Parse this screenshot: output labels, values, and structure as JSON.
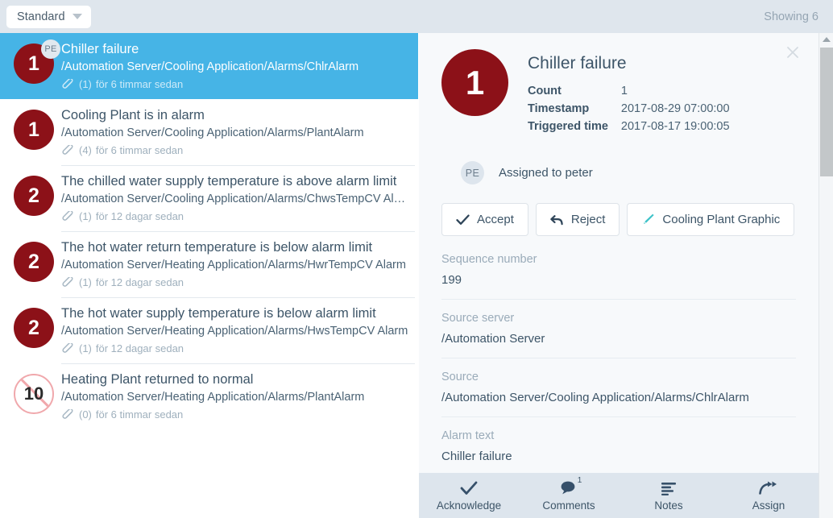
{
  "topbar": {
    "filter_label": "Standard",
    "filter_caret_icon": "chevron-down-icon",
    "showing_text": "Showing 6"
  },
  "alarm_list": {
    "rows": [
      {
        "count": "1",
        "badge_style": "alarm",
        "assignee_initials": "PE",
        "title": "Chiller failure",
        "path": "/Automation Server/Cooling Application/Alarms/ChlrAlarm",
        "attachments": "(1)",
        "age": "för 6 timmar sedan",
        "selected": true
      },
      {
        "count": "1",
        "badge_style": "alarm",
        "assignee_initials": "",
        "title": "Cooling Plant is in alarm",
        "path": "/Automation Server/Cooling Application/Alarms/PlantAlarm",
        "attachments": "(4)",
        "age": "för 6 timmar sedan",
        "selected": false
      },
      {
        "count": "2",
        "badge_style": "alarm",
        "assignee_initials": "",
        "title": "The chilled water supply temperature is above alarm limit",
        "path": "/Automation Server/Cooling Application/Alarms/ChwsTempCV Ala…",
        "attachments": "(1)",
        "age": "för 12 dagar sedan",
        "selected": false
      },
      {
        "count": "2",
        "badge_style": "alarm",
        "assignee_initials": "",
        "title": "The hot water return temperature is below alarm limit",
        "path": "/Automation Server/Heating Application/Alarms/HwrTempCV Alarm",
        "attachments": "(1)",
        "age": "för 12 dagar sedan",
        "selected": false
      },
      {
        "count": "2",
        "badge_style": "alarm",
        "assignee_initials": "",
        "title": "The hot water supply temperature is below alarm limit",
        "path": "/Automation Server/Heating Application/Alarms/HwsTempCV Alarm",
        "attachments": "(1)",
        "age": "för 12 dagar sedan",
        "selected": false
      },
      {
        "count": "10",
        "badge_style": "normal",
        "assignee_initials": "",
        "title": "Heating Plant returned to normal",
        "path": "/Automation Server/Heating Application/Alarms/PlantAlarm",
        "attachments": "(0)",
        "age": "för 6 timmar sedan",
        "selected": false
      }
    ]
  },
  "detail": {
    "close_icon": "close-icon",
    "badge_count": "1",
    "title": "Chiller failure",
    "summary": [
      {
        "key": "Count",
        "value": "1"
      },
      {
        "key": "Timestamp",
        "value": "2017-08-29 07:00:00"
      },
      {
        "key": "Triggered time",
        "value": "2017-08-17 19:00:05"
      }
    ],
    "assigned": {
      "initials": "PE",
      "text": "Assigned to peter"
    },
    "buttons": [
      {
        "label": "Accept",
        "icon": "check-icon"
      },
      {
        "label": "Reject",
        "icon": "reply-arrow-icon"
      },
      {
        "label": "Cooling Plant Graphic",
        "icon": "pen-icon"
      }
    ],
    "fields": [
      {
        "label": "Sequence number",
        "value": "199"
      },
      {
        "label": "Source server",
        "value": "/Automation Server"
      },
      {
        "label": "Source",
        "value": "/Automation Server/Cooling Application/Alarms/ChlrAlarm"
      },
      {
        "label": "Alarm text",
        "value": "Chiller failure"
      }
    ]
  },
  "bottom_toolbar": {
    "items": [
      {
        "label": "Acknowledge",
        "icon": "check-icon",
        "badge": ""
      },
      {
        "label": "Comments",
        "icon": "comment-bubble-icon",
        "badge": "1"
      },
      {
        "label": "Notes",
        "icon": "notes-lines-icon",
        "badge": ""
      },
      {
        "label": "Assign",
        "icon": "assign-arrow-icon",
        "badge": ""
      }
    ]
  },
  "colors": {
    "selected_row": "#46b4e6",
    "alarm_badge": "#8c1118",
    "normal_badge_border": "#f0a8ac",
    "topbar_bg": "#dfe6ed",
    "detail_bg": "#f7f9fb",
    "toolbar_bg": "#dde5ed",
    "accent_pen": "#3fc3c9"
  }
}
